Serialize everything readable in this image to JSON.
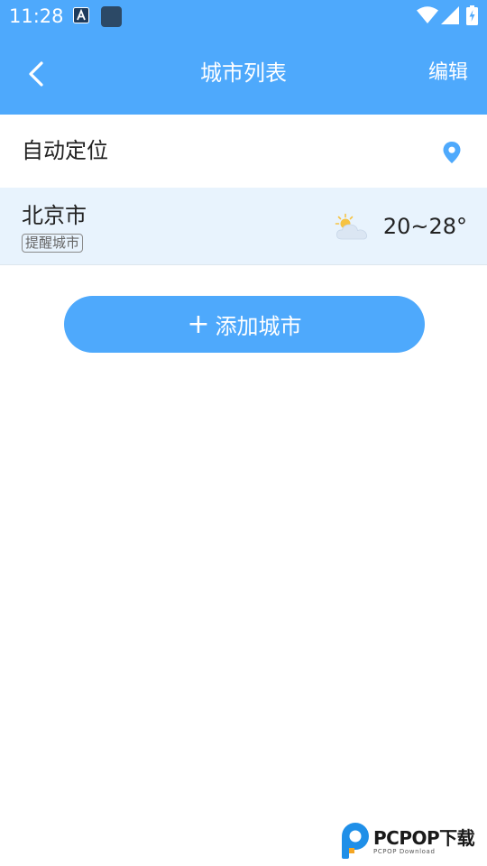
{
  "status_bar": {
    "time": "11:28"
  },
  "nav": {
    "title": "城市列表",
    "edit_label": "编辑"
  },
  "auto_location": {
    "label": "自动定位"
  },
  "cities": [
    {
      "name": "北京市",
      "tag": "提醒城市",
      "weather_icon": "partly-cloudy-icon",
      "temperature": "20~28°"
    }
  ],
  "add_city": {
    "plus": "+",
    "label": "添加城市"
  },
  "watermark": {
    "text": "PCPOP下载",
    "subtext": "PCPOP Download"
  },
  "colors": {
    "primary": "#4ea9fc",
    "row_highlight": "#e8f3fd",
    "text": "#222222"
  }
}
